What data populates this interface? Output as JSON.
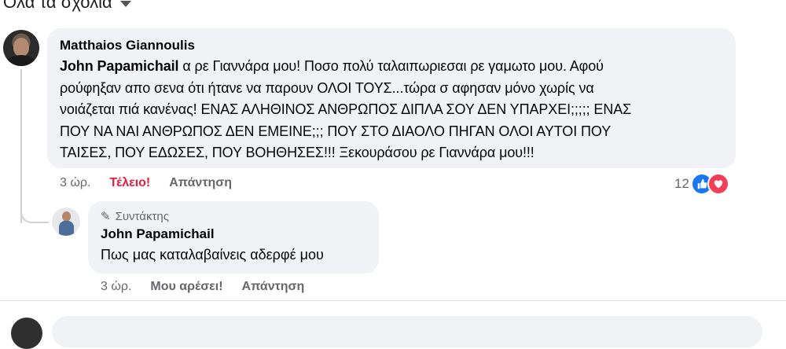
{
  "filter": {
    "label": "Όλα τα σχόλια"
  },
  "comment": {
    "author": "Matthaios Giannoulis",
    "mention": "John Papamichail",
    "lines": [
      " α ρε Γιαννάρα μου! Ποσο πολύ ταλαιπωριεσαι ρε γαμωτο μου. Αφού",
      "ρούφηξαν απο σενα ότι ήτανε να παρουν ΟΛΟΙ ΤΟΥΣ...τώρα σ αφησαν μόνο χωρίς να",
      "νοιάζεται πιά κανένας! ΕΝΑΣ ΑΛΗΘΙΝΟΣ ΑΝΘΡΩΠΟΣ ΔΙΠΛΑ ΣΟΥ ΔΕΝ ΥΠΑΡΧΕΙ;;;;; ΕΝΑΣ",
      "ΠΟΥ ΝΑ ΝΑΙ ΑΝΘΡΩΠΟΣ ΔΕΝ ΕΜΕΙΝΕ;;; ΠΟΥ ΣΤΟ ΔΙΑΟΛΟ ΠΗΓΑΝ ΟΛΟΙ ΑΥΤΟΙ ΠΟΥ",
      "ΤΑΙΣΕΣ, ΠΟΥ ΕΔΩΣΕΣ, ΠΟΥ ΒΟΗΘΗΣΕΣ!!! Ξεκουράσου ρε Γιαννάρα μου!!!"
    ],
    "time": "3 ώρ.",
    "reaction_label": "Τέλειο!",
    "reply_label": "Απάντηση",
    "reaction_count": "12",
    "icons": [
      "like-icon",
      "love-icon"
    ],
    "colors": {
      "love": "#e41e3f",
      "like": "#1877f2"
    }
  },
  "reply": {
    "badge": "Συντάκτης",
    "author": "John Papamichail",
    "text": "Πως μας καταλαβαίνεις αδερφέ μου",
    "time": "3 ώρ.",
    "like_label": "Μου αρέσει!",
    "reply_label": "Απάντηση"
  }
}
